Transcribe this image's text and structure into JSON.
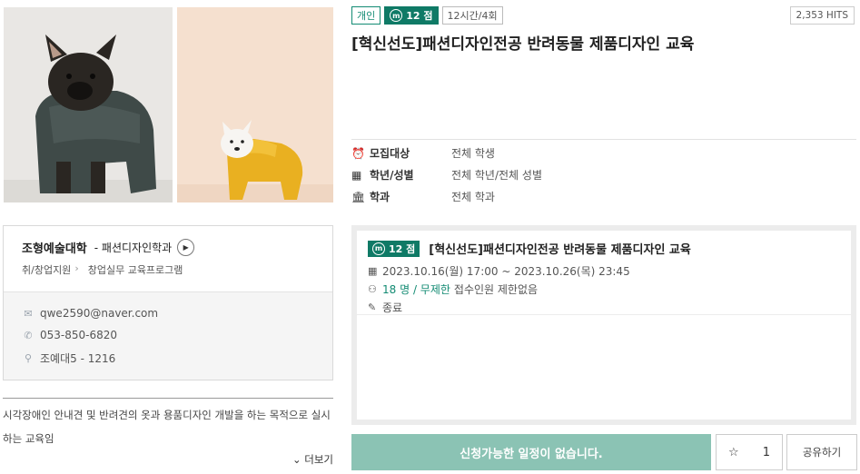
{
  "photos": {
    "left_alt_icon": "dog-in-grey-raincoat-photo",
    "right_alt_icon": "dog-in-yellow-raincoat-photo"
  },
  "org": {
    "college": "조형예술대학",
    "department": "- 패션디자인학과",
    "crumbs": [
      "취/창업지원",
      "창업실무 교육프로그램"
    ],
    "email": "qwe2590@naver.com",
    "phone": "053-850-6820",
    "location": "조예대5 - 1216"
  },
  "description": "시각장애인 안내견 및 반려견의 옷과 용품디자인 개발을 하는 목적으로 실시하는 교육임",
  "more_label": "더보기",
  "tags": {
    "type": "개인",
    "points": "12 점",
    "time": "12시간/4회"
  },
  "hits": "2,353 HITS",
  "title": "[혁신선도]패션디자인전공 반려동물 제품디자인 교육",
  "meta": [
    {
      "icon": "alarm-clock-icon",
      "label": "모집대상",
      "value": "전체 학생"
    },
    {
      "icon": "calendar-icon",
      "label": "학년/성별",
      "value": "전체 학년/전체 성별"
    },
    {
      "icon": "building-icon",
      "label": "학과",
      "value": "전체 학과"
    }
  ],
  "session": {
    "points": "12 점",
    "title": "[혁신선도]패션디자인전공 반려동물 제품디자인 교육",
    "period": "2023.10.16(월) 17:00 ~ 2023.10.26(목) 23:45",
    "count": "18 명 / 무제한",
    "count_note": "접수인원 제한없음",
    "status": "종료"
  },
  "actions": {
    "apply_label": "신청가능한 일정이 없습니다.",
    "like_count": "1",
    "share_label": "공유하기"
  },
  "colors": {
    "accent": "#0f7a66",
    "apply_bg": "#8bc3b4"
  }
}
